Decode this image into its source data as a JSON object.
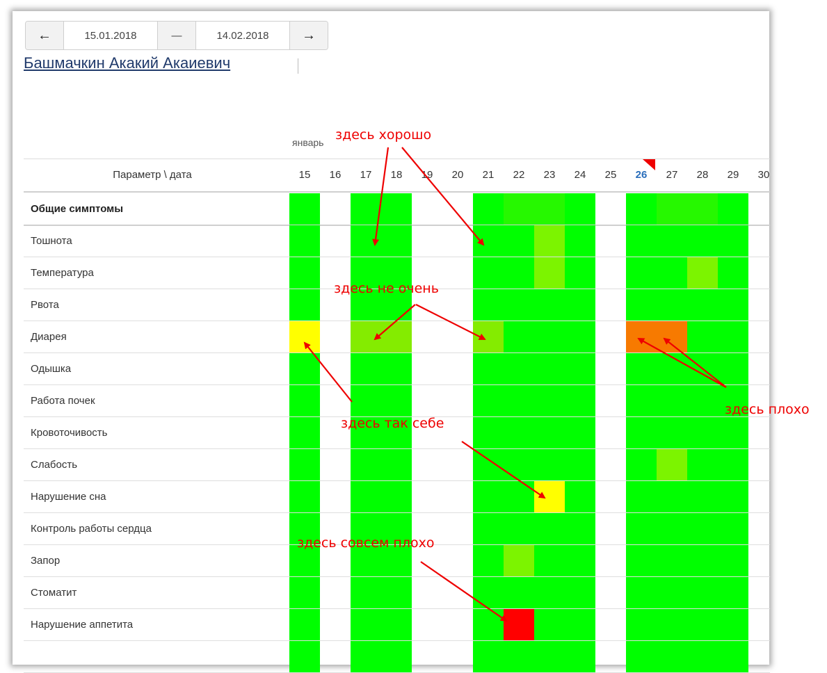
{
  "date_range": {
    "prev_label": "←",
    "start": "15.01.2018",
    "separator": "—",
    "end": "14.02.2018",
    "next_label": "→"
  },
  "patient_name": "Башмачкин Акакий Акаиевич",
  "table": {
    "month_label": "январь",
    "param_header": "Параметр \\ дата",
    "days": [
      "15",
      "16",
      "17",
      "18",
      "19",
      "20",
      "21",
      "22",
      "23",
      "24",
      "25",
      "26",
      "27",
      "28",
      "29",
      "30"
    ],
    "today": "26",
    "colors": {
      "G": "#00ff00",
      "g": "#26f800",
      "L": "#7cf400",
      "l": "#84ec00",
      "Y": "#ffff00",
      "O": "#f77a00",
      "R": "#ff0000"
    },
    "rows": [
      {
        "label": "Общие симптомы",
        "group": true,
        "cells": "G.GG..GggG.GggG."
      },
      {
        "label": "Тошнота",
        "cells": "G.GG..GGLG.GGGG."
      },
      {
        "label": "Температура",
        "cells": "G.GG..GGLG.GGLG."
      },
      {
        "label": "Рвота",
        "cells": "G.GG..GGGG.GGGG."
      },
      {
        "label": "Диарея",
        "cells": "Y.ll..lGGG.OOGG."
      },
      {
        "label": "Одышка",
        "cells": "G.GG..GGGG.GGGG."
      },
      {
        "label": "Работа почек",
        "cells": "G.GG..GGGG.GGGG."
      },
      {
        "label": "Кровоточивость",
        "cells": "G.GG..GGGG.GGGG."
      },
      {
        "label": "Слабость",
        "cells": "G.GG..GGGG.GLGG."
      },
      {
        "label": "Нарушение сна",
        "cells": "G.GG..GGYG.GGGG."
      },
      {
        "label": "Контроль работы сердца",
        "cells": "G.GG..GGGG.GGGG."
      },
      {
        "label": "Запор",
        "cells": "G.GG..GLGG.GGGG."
      },
      {
        "label": "Стоматит",
        "cells": "G.GG..GGGG.GGGG."
      },
      {
        "label": "Нарушение аппетита",
        "cells": "G.GG..GRGG.GGGG."
      },
      {
        "label": "",
        "cells": "G.GG..GGGG.GGGG."
      }
    ]
  },
  "annotations": {
    "good": "здесь хорошо",
    "not_very": "здесь не очень",
    "so_so": "здесь так себе",
    "bad": "здесь плохо",
    "very_bad": "здесь совсем плохо",
    "color": "#ee0000"
  }
}
